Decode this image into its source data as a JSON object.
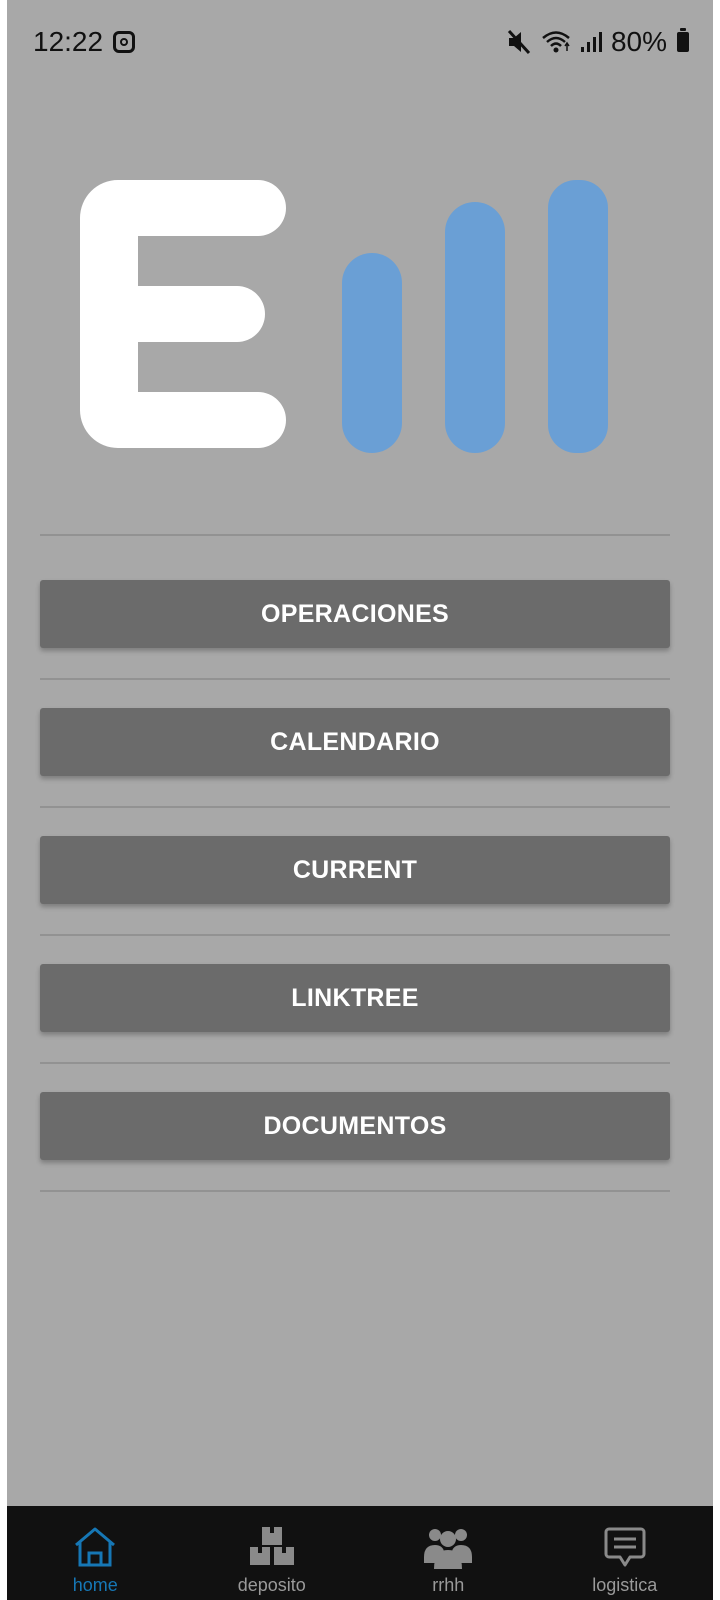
{
  "status_bar": {
    "time": "12:22",
    "battery": "80%",
    "icons": [
      "instagram-icon",
      "mute-icon",
      "wifi-icon",
      "signal-icon",
      "battery-icon"
    ]
  },
  "logo": {
    "letter_color": "#ffffff",
    "bar_color": "#6a9fd5"
  },
  "menu": {
    "items": [
      {
        "label": "OPERACIONES"
      },
      {
        "label": "CALENDARIO"
      },
      {
        "label": "CURRENT"
      },
      {
        "label": "LINKTREE"
      },
      {
        "label": "DOCUMENTOS"
      }
    ]
  },
  "bottom_nav": {
    "active_color": "#1677b5",
    "items": [
      {
        "label": "home",
        "icon": "home-icon",
        "active": true
      },
      {
        "label": "deposito",
        "icon": "boxes-icon",
        "active": false
      },
      {
        "label": "rrhh",
        "icon": "people-icon",
        "active": false
      },
      {
        "label": "logistica",
        "icon": "message-icon",
        "active": false
      }
    ]
  }
}
